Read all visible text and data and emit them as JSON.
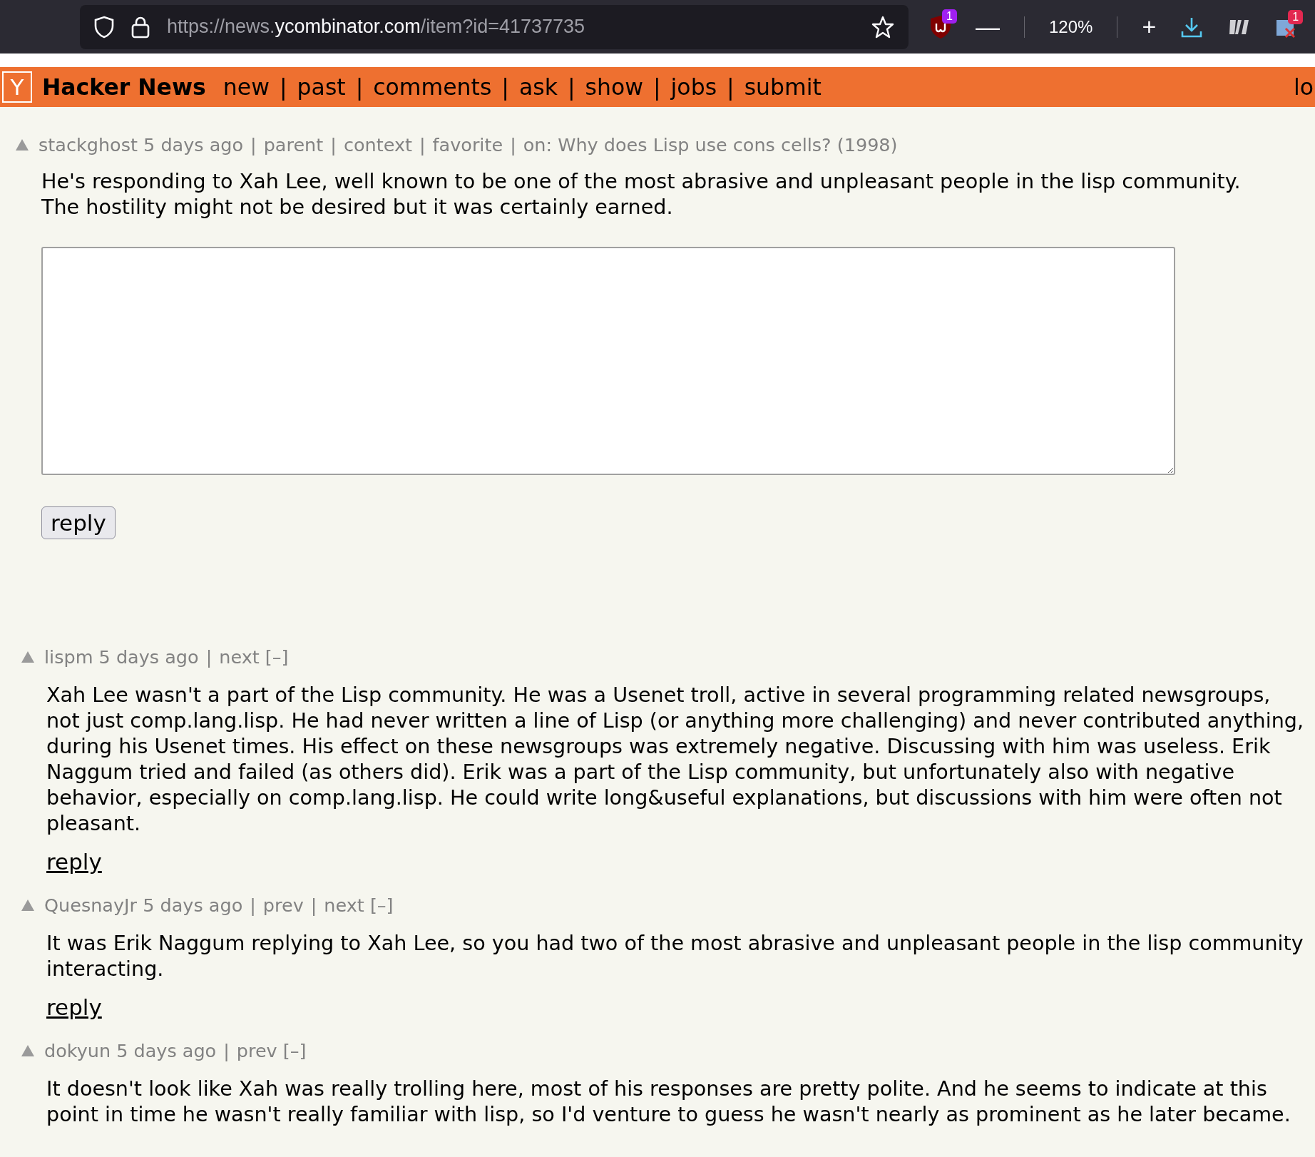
{
  "browser": {
    "url_prefix": "https://news.",
    "url_domain": "ycombinator.com",
    "url_suffix": "/item?id=41737735",
    "extension_badge": "1",
    "zoom": "120%",
    "zoom_out": "—",
    "zoom_in": "+",
    "addon_badge": "1"
  },
  "header": {
    "logo": "Y",
    "site_name": "Hacker News",
    "separator": "|",
    "nav": [
      "new",
      "past",
      "comments",
      "ask",
      "show",
      "jobs",
      "submit"
    ],
    "login": "lo"
  },
  "focus_comment": {
    "user": "stackghost",
    "age": "5 days ago",
    "links": [
      "parent",
      "context",
      "favorite",
      "on: Why does Lisp use cons cells? (1998)"
    ],
    "text": "He's responding to Xah Lee, well known to be one of the most abrasive and unpleasant people in the lisp community. The hostility might not be desired but it was certainly earned.",
    "reply_button": "reply"
  },
  "comments": [
    {
      "user": "lispm",
      "age": "5 days ago",
      "links": [
        "next [–]"
      ],
      "text": "Xah Lee wasn't a part of the Lisp community. He was a Usenet troll, active in several programming related newsgroups, not just comp.lang.lisp. He had never written a line of Lisp (or anything more challenging) and never contributed anything, during his Usenet times. His effect on these newsgroups was extremely negative. Discussing with him was useless. Erik Naggum tried and failed (as others did). Erik was a part of the Lisp community, but unfortunately also with negative behavior, especially on comp.lang.lisp. He could write long&useful explanations, but discussions with him were often not pleasant.",
      "reply": "reply"
    },
    {
      "user": "QuesnayJr",
      "age": "5 days ago",
      "links": [
        "prev",
        "next [–]"
      ],
      "text": "It was Erik Naggum replying to Xah Lee, so you had two of the most abrasive and unpleasant people in the lisp community interacting.",
      "reply": "reply"
    },
    {
      "user": "dokyun",
      "age": "5 days ago",
      "links": [
        "prev [–]"
      ],
      "text": "It doesn't look like Xah was really trolling here, most of his responses are pretty polite. And he seems to indicate at this point in time he wasn't really familiar with lisp, so I'd venture to guess he wasn't nearly as prominent as he later became."
    }
  ]
}
